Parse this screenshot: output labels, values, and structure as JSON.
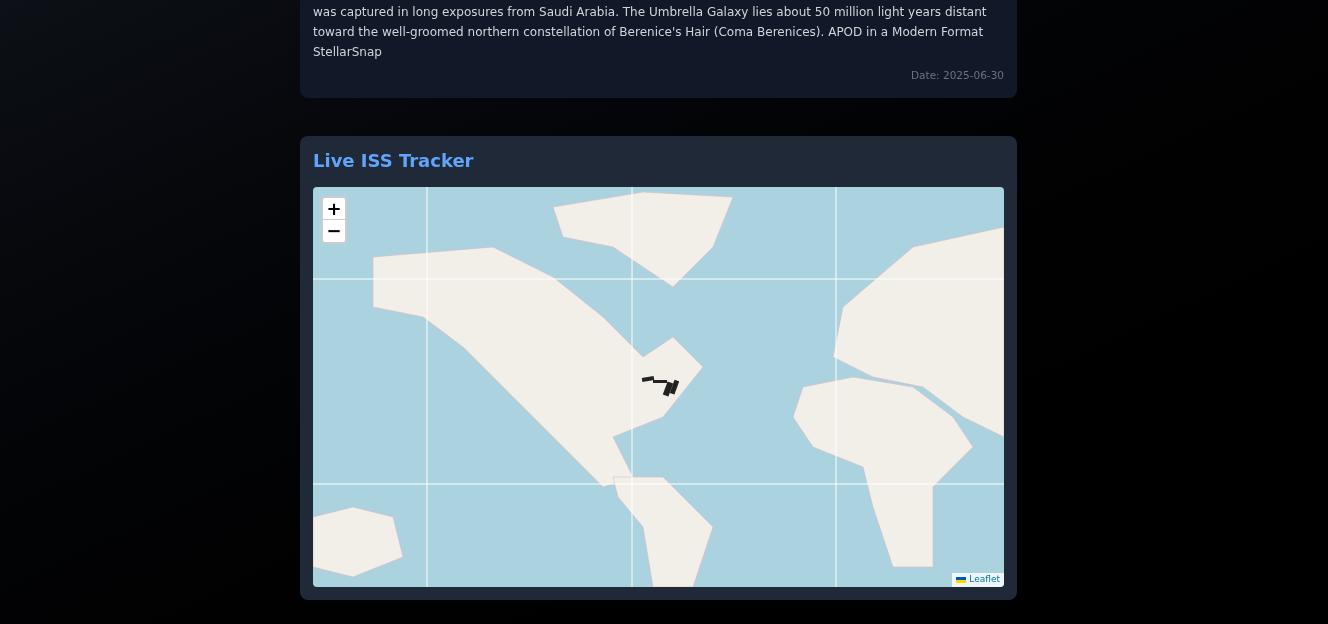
{
  "apod_card": {
    "description": "was captured in long exposures from Saudi Arabia. The Umbrella Galaxy lies about 50 million light years distant toward the well-groomed northern constellation of Berenice's Hair (Coma Berenices). APOD in a Modern Format StellarSnap",
    "date": "Date: 2025-06-30"
  },
  "iss_card": {
    "title": "Live ISS Tracker",
    "map": {
      "zoom_in": "+",
      "zoom_out": "−",
      "attribution": "Leaflet"
    }
  }
}
